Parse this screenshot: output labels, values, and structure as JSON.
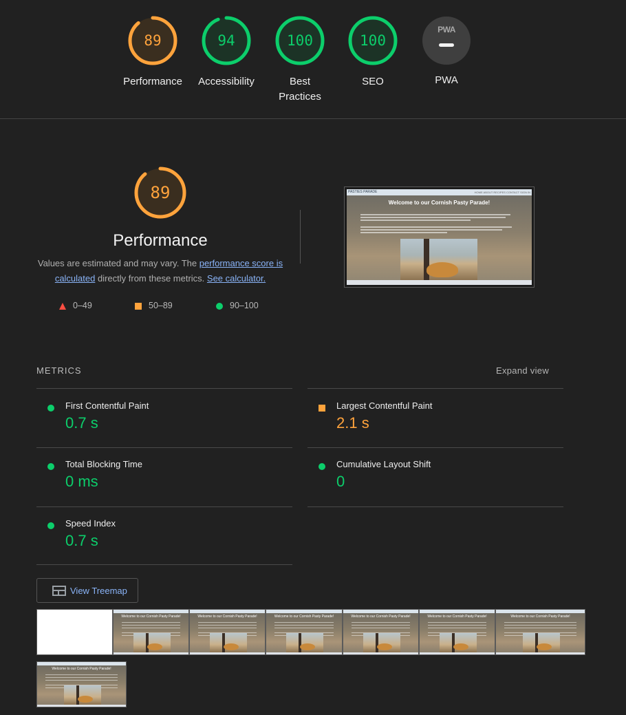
{
  "scores": [
    {
      "label": "Performance",
      "score": "89",
      "value": 89,
      "color": "#ffa33c"
    },
    {
      "label": "Accessibility",
      "score": "94",
      "value": 94,
      "color": "#0cce6b"
    },
    {
      "label": "Best Practices",
      "score": "100",
      "value": 100,
      "color": "#0cce6b"
    },
    {
      "label": "SEO",
      "score": "100",
      "value": 100,
      "color": "#0cce6b"
    }
  ],
  "pwa": {
    "badge": "PWA",
    "label": "PWA"
  },
  "performance": {
    "score": "89",
    "value": 89,
    "title": "Performance",
    "desc_prefix": "Values are estimated and may vary. The ",
    "link_score": "performance score is calculated",
    "desc_middle": " directly from these metrics. ",
    "link_calc": "See calculator."
  },
  "legend": [
    {
      "range": "0–49",
      "marker": "triangle",
      "color": "#ff4e42"
    },
    {
      "range": "50–89",
      "marker": "square",
      "color": "#ffa33c"
    },
    {
      "range": "90–100",
      "marker": "circle",
      "color": "#0cce6b"
    }
  ],
  "screenshot": {
    "site_name": "PASTIES PARADE",
    "nav_links": "HOME  ABOUT  RECIPES  CONTACT  SIGN IN",
    "heading": "Welcome to our Cornish Pasty Parade!"
  },
  "metrics": {
    "heading": "METRICS",
    "expand": "Expand view",
    "items": [
      {
        "name": "First Contentful Paint",
        "value": "0.7 s",
        "status": "pass"
      },
      {
        "name": "Largest Contentful Paint",
        "value": "2.1 s",
        "status": "average"
      },
      {
        "name": "Total Blocking Time",
        "value": "0 ms",
        "status": "pass"
      },
      {
        "name": "Cumulative Layout Shift",
        "value": "0",
        "status": "pass"
      },
      {
        "name": "Speed Index",
        "value": "0.7 s",
        "status": "pass"
      }
    ]
  },
  "treemap": {
    "label": "View Treemap"
  },
  "filmstrip": {
    "frame_title": "Welcome to our Cornish Pasty Parade!"
  }
}
